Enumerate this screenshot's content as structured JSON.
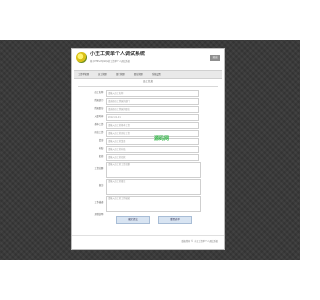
{
  "app": {
    "title": "小王工资单个人调试系统",
    "subtitle": "基于PHP+MySQL的工资单个人调试系统",
    "logout_label": "退出"
  },
  "nav": {
    "items": [
      {
        "label": "工资单管理"
      },
      {
        "label": "员工管理"
      },
      {
        "label": "部门管理"
      },
      {
        "label": "职位管理"
      },
      {
        "label": "系统设置"
      }
    ]
  },
  "section": {
    "title": "员工信息"
  },
  "form": {
    "fields": [
      {
        "label": "员工名称:",
        "value": "请输入员工名称"
      },
      {
        "label": "所属部门:",
        "value": "请选择员工所属的部门"
      },
      {
        "label": "所属职位:",
        "value": "请选择员工所属的职位"
      },
      {
        "label": "入职时间:",
        "value": "2012-01-01"
      },
      {
        "label": "基本工资:",
        "value": "请输入员工的基本工资"
      },
      {
        "label": "岗位工资:",
        "value": "请输入员工的岗位工资"
      },
      {
        "label": "奖金:",
        "value": "请输入员工的奖金"
      },
      {
        "label": "补贴:",
        "value": "请输入员工的补贴"
      },
      {
        "label": "扣款:",
        "value": "请输入员工的扣款"
      },
      {
        "label": "工资总额:",
        "value": "请输入员工的工资总额"
      },
      {
        "label": "备注:",
        "value": "请输入员工的备注"
      },
      {
        "label": "工作描述:",
        "value": "请输入员工的工作描述"
      },
      {
        "label": "其他说明:",
        "value": "请输入员工的其他说明"
      }
    ],
    "submit_label": "确定提交",
    "reset_label": "重置表单"
  },
  "watermark": "源码网",
  "footer": {
    "text": "版权所有 © 小王工资单个人调试系统"
  }
}
